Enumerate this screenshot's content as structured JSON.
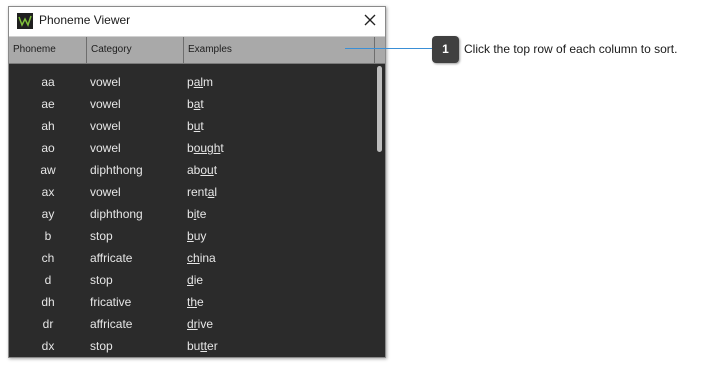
{
  "window": {
    "title": "Phoneme Viewer",
    "icon": "waveform-logo-icon"
  },
  "columns": [
    "Phoneme",
    "Category",
    "Examples"
  ],
  "rows": [
    {
      "phoneme": "aa",
      "category": "vowel",
      "example": [
        [
          "p",
          ""
        ],
        [
          "al",
          "u"
        ],
        [
          "m",
          ""
        ]
      ]
    },
    {
      "phoneme": "ae",
      "category": "vowel",
      "example": [
        [
          "b",
          ""
        ],
        [
          "a",
          "u"
        ],
        [
          "t",
          ""
        ]
      ]
    },
    {
      "phoneme": "ah",
      "category": "vowel",
      "example": [
        [
          "b",
          ""
        ],
        [
          "u",
          "u"
        ],
        [
          "t",
          ""
        ]
      ]
    },
    {
      "phoneme": "ao",
      "category": "vowel",
      "example": [
        [
          "b",
          ""
        ],
        [
          "ough",
          "u"
        ],
        [
          "t",
          ""
        ]
      ]
    },
    {
      "phoneme": "aw",
      "category": "diphthong",
      "example": [
        [
          "ab",
          ""
        ],
        [
          "ou",
          "u"
        ],
        [
          "t",
          ""
        ]
      ]
    },
    {
      "phoneme": "ax",
      "category": "vowel",
      "example": [
        [
          "rent",
          ""
        ],
        [
          "a",
          "u"
        ],
        [
          "l",
          ""
        ]
      ]
    },
    {
      "phoneme": "ay",
      "category": "diphthong",
      "example": [
        [
          "b",
          ""
        ],
        [
          "i",
          "u"
        ],
        [
          "te",
          ""
        ]
      ]
    },
    {
      "phoneme": "b",
      "category": "stop",
      "example": [
        [
          "b",
          "u"
        ],
        [
          "uy",
          ""
        ]
      ]
    },
    {
      "phoneme": "ch",
      "category": "affricate",
      "example": [
        [
          "ch",
          "u"
        ],
        [
          "ina",
          ""
        ]
      ]
    },
    {
      "phoneme": "d",
      "category": "stop",
      "example": [
        [
          "d",
          "u"
        ],
        [
          "ie",
          ""
        ]
      ]
    },
    {
      "phoneme": "dh",
      "category": "fricative",
      "example": [
        [
          "th",
          "u"
        ],
        [
          "e",
          ""
        ]
      ]
    },
    {
      "phoneme": "dr",
      "category": "affricate",
      "example": [
        [
          "dr",
          "u"
        ],
        [
          "ive",
          ""
        ]
      ]
    },
    {
      "phoneme": "dx",
      "category": "stop",
      "example": [
        [
          "bu",
          ""
        ],
        [
          "tt",
          "u"
        ],
        [
          "er",
          ""
        ]
      ]
    }
  ],
  "callout": {
    "number": "1",
    "text": "Click the top row of each column to sort."
  },
  "colors": {
    "list_bg": "#2b2b2b",
    "header_bg": "#a9a9a9",
    "callout_line": "#3a8fd6",
    "badge_bg": "#404040"
  }
}
